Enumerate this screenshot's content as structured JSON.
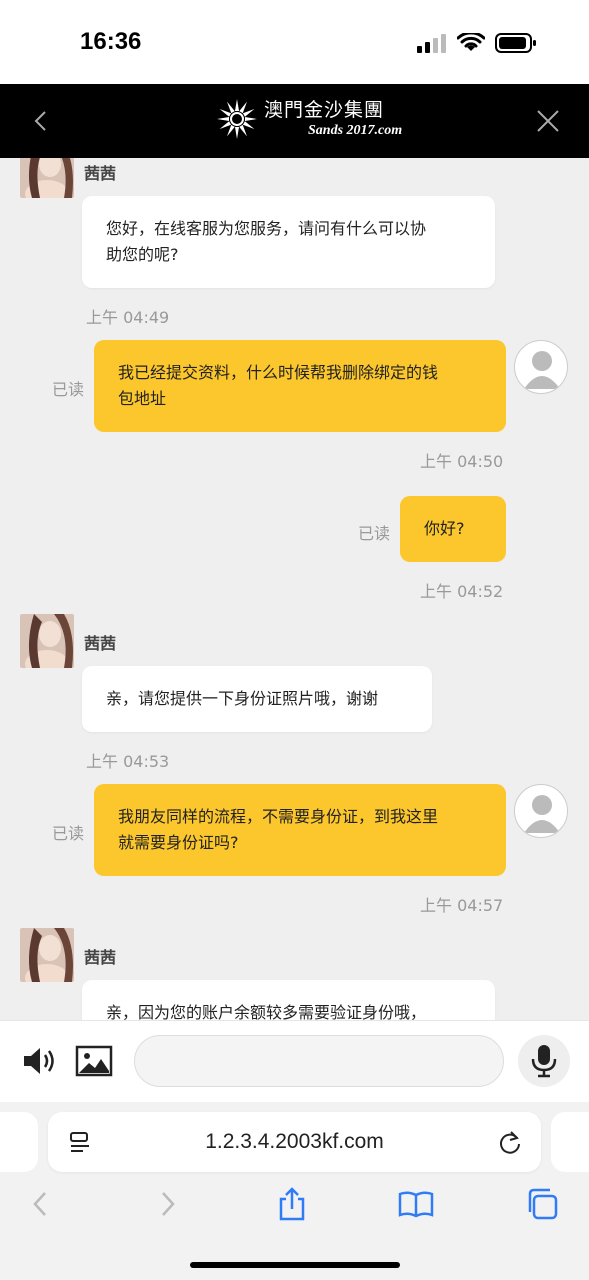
{
  "status_bar": {
    "time": "16:36"
  },
  "header": {
    "logo_cn": "澳門金沙集團",
    "logo_en": "Sands 2017.com"
  },
  "messages": [
    {
      "side": "agent",
      "name": "茜茜",
      "lines": [
        "您好，在线客服为您服务，请问有什么可以协",
        "助您的呢?"
      ],
      "time": "上午 04:49"
    },
    {
      "side": "user",
      "read": "已读",
      "lines": [
        "我已经提交资料，什么时候帮我删除绑定的钱",
        "包地址"
      ],
      "time": "上午 04:50"
    },
    {
      "side": "user",
      "read": "已读",
      "lines": [
        "你好?"
      ],
      "time": "上午 04:52"
    },
    {
      "side": "agent",
      "name": "茜茜",
      "lines": [
        "亲，请您提供一下身份证照片哦，谢谢"
      ],
      "time": "上午 04:53"
    },
    {
      "side": "user",
      "read": "已读",
      "lines": [
        "我朋友同样的流程，不需要身份证，到我这里",
        "就需要身份证吗?"
      ],
      "time": "上午 04:57"
    },
    {
      "side": "agent",
      "name": "茜茜",
      "lines": [
        "亲，因为您的账户余额较多需要验证身份哦，"
      ]
    }
  ],
  "input": {
    "placeholder": ""
  },
  "browser": {
    "url": "1.2.3.4.2003kf.com"
  },
  "colors": {
    "user_bubble": "#fcc72c",
    "agent_bubble": "#ffffff",
    "header_bg": "#000000",
    "safari_accent": "#2f7cf6"
  }
}
